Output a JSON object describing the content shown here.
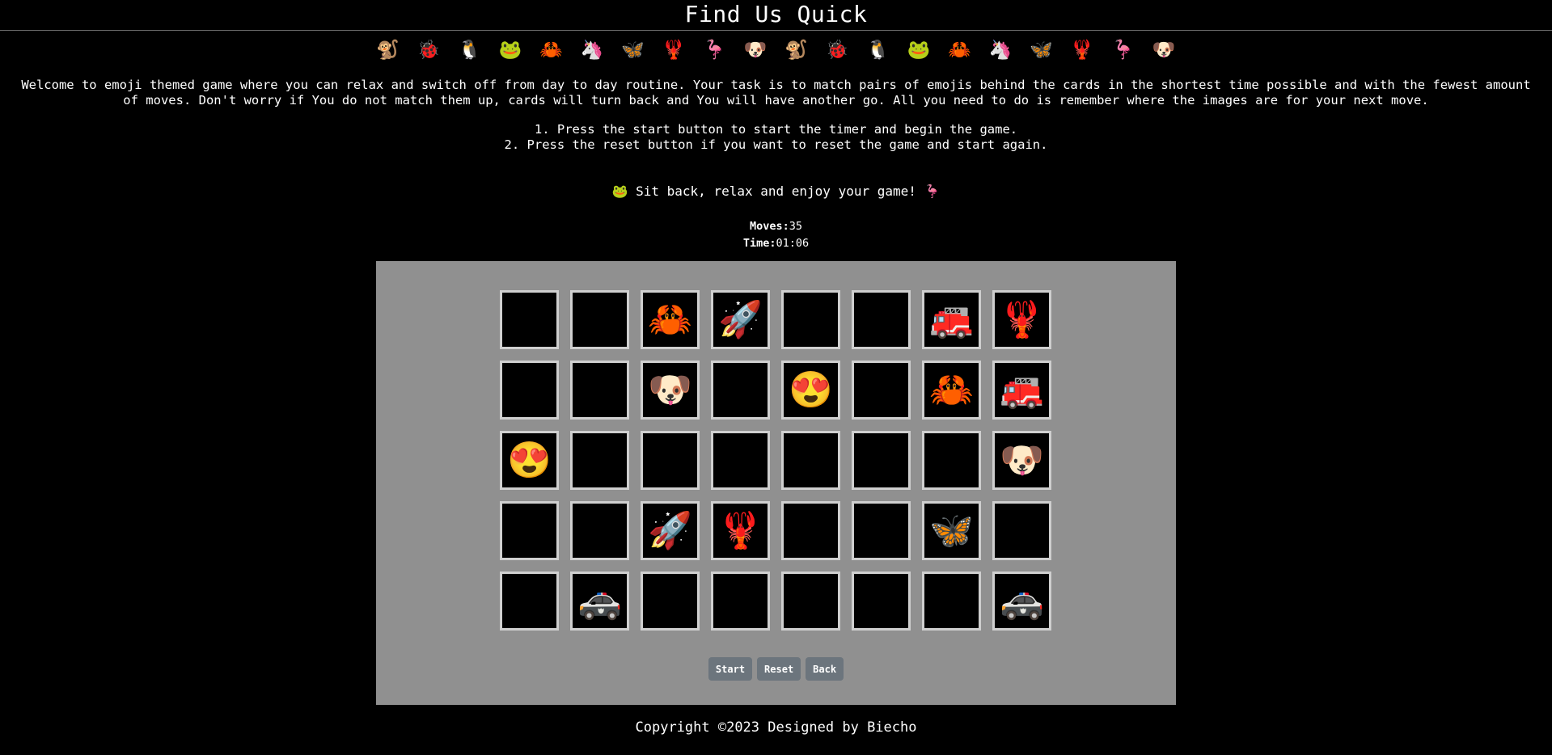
{
  "header": {
    "title": "Find Us Quick"
  },
  "emoji_strip": [
    "🐒",
    "🐞",
    "🐧",
    "🐸",
    "🦀",
    "🦄",
    "🦋",
    "🦞",
    "🦩",
    "🐶",
    "🐒",
    "🐞",
    "🐧",
    "🐸",
    "🦀",
    "🦄",
    "🦋",
    "🦞",
    "🦩",
    "🐶"
  ],
  "intro": {
    "text": "Welcome to emoji themed game where you can relax and switch off from day to day routine. Your task is to match pairs of emojis behind the cards in the shortest time possible and with the fewest amount of moves. Don't worry if You do not match them up, cards will turn back and You will have another go. All you need to do is remember where the images are for your next move."
  },
  "steps": [
    "1. Press the start button to start the timer and begin the game.",
    "2. Press the reset button if you want to reset the game and start again."
  ],
  "relax": {
    "left_emoji": "🐸",
    "text": "Sit back, relax and enjoy your game!",
    "right_emoji": "🦩"
  },
  "stats": {
    "moves_label": "Moves:",
    "moves_value": "35",
    "time_label": "Time:",
    "time_value": "01:06"
  },
  "board": {
    "background_color": "#909090",
    "card_back_color": "#000000",
    "card_border_color": "#cfcfcf",
    "cards": [
      [
        "",
        "",
        "🦀",
        "🚀",
        "",
        "",
        "🚒",
        "🦞"
      ],
      [
        "",
        "",
        "🐶",
        "",
        "😍",
        "",
        "🦀",
        "🚒"
      ],
      [
        "😍",
        "",
        "",
        "",
        "",
        "",
        "",
        "🐶"
      ],
      [
        "",
        "",
        "🚀",
        "🦞",
        "",
        "",
        "🦋",
        ""
      ],
      [
        "",
        "🚓",
        "",
        "",
        "",
        "",
        "",
        "🚓"
      ]
    ]
  },
  "controls": {
    "start_label": "Start",
    "reset_label": "Reset",
    "back_label": "Back",
    "button_color": "#6c757d"
  },
  "footer": {
    "text": "Copyright ©2023 Designed by Biecho"
  }
}
